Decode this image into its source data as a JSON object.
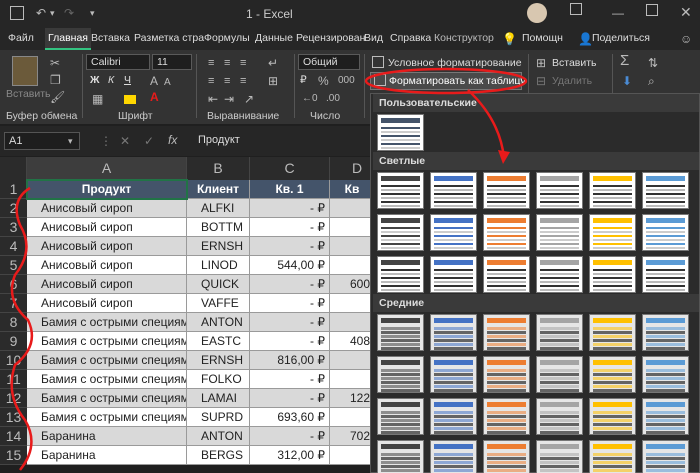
{
  "titlebar": {
    "doc_title": "1  -  Excel"
  },
  "tabs": [
    "Файл",
    "Главная",
    "Вставка",
    "Разметка стра",
    "Формулы",
    "Данные",
    "Рецензирован",
    "Вид",
    "Справка",
    "Конструктор",
    "Помощн",
    "Поделиться"
  ],
  "ribbon": {
    "paste_label": "Вставить",
    "font_name": "Calibri",
    "font_size": "11",
    "number_format": "Общий",
    "cond_format": "Условное форматирование",
    "format_table": "Форматировать как таблицу",
    "insert_label": "Вставить",
    "delete_label": "Удалить",
    "groups": {
      "clipboard": "Буфер обмена",
      "font": "Шрифт",
      "alignment": "Выравнивание",
      "number": "Число"
    },
    "bold": "Ж",
    "italic": "К",
    "underline": "Ч",
    "currency": "₽"
  },
  "formula_bar": {
    "name_box": "A1",
    "fx": "fx",
    "value": "Продукт"
  },
  "grid": {
    "columns": [
      "A",
      "B",
      "C",
      "D"
    ],
    "rows": [
      {
        "n": "1",
        "a": "Продукт",
        "b": "Клиент",
        "c": "Кв. 1",
        "d": "Кв"
      },
      {
        "n": "2",
        "a": "Анисовый сироп",
        "b": "ALFKI",
        "c": "-    ₽",
        "d": ""
      },
      {
        "n": "3",
        "a": "Анисовый сироп",
        "b": "BOTTM",
        "c": "-    ₽",
        "d": ""
      },
      {
        "n": "4",
        "a": "Анисовый сироп",
        "b": "ERNSH",
        "c": "-    ₽",
        "d": ""
      },
      {
        "n": "5",
        "a": "Анисовый сироп",
        "b": "LINOD",
        "c": "544,00 ₽",
        "d": ""
      },
      {
        "n": "6",
        "a": "Анисовый сироп",
        "b": "QUICK",
        "c": "-    ₽",
        "d": "600"
      },
      {
        "n": "7",
        "a": "Анисовый сироп",
        "b": "VAFFE",
        "c": "-    ₽",
        "d": ""
      },
      {
        "n": "8",
        "a": "Бамия с острыми специями",
        "b": "ANTON",
        "c": "-    ₽",
        "d": ""
      },
      {
        "n": "9",
        "a": "Бамия с острыми специями",
        "b": "EASTC",
        "c": "-    ₽",
        "d": "408"
      },
      {
        "n": "10",
        "a": "Бамия с острыми специями",
        "b": "ERNSH",
        "c": "816,00 ₽",
        "d": ""
      },
      {
        "n": "11",
        "a": "Бамия с острыми специями",
        "b": "FOLKO",
        "c": "-    ₽",
        "d": ""
      },
      {
        "n": "12",
        "a": "Бамия с острыми специями",
        "b": "LAMAI",
        "c": "-    ₽",
        "d": "122"
      },
      {
        "n": "13",
        "a": "Бамия с острыми специями",
        "b": "SUPRD",
        "c": "693,60 ₽",
        "d": ""
      },
      {
        "n": "14",
        "a": "Баранина",
        "b": "ANTON",
        "c": "-    ₽",
        "d": "702"
      },
      {
        "n": "15",
        "a": "Баранина",
        "b": "BERGS",
        "c": "312,00 ₽",
        "d": ""
      }
    ]
  },
  "gallery": {
    "sections": {
      "custom": "Пользовательские",
      "light": "Светлые",
      "medium": "Средние"
    },
    "light_colors": [
      "#444444",
      "#4472c4",
      "#ed7d31",
      "#a5a5a5",
      "#ffc000",
      "#5b9bd5"
    ],
    "medium_colors": [
      "#444444",
      "#4472c4",
      "#ed7d31",
      "#a5a5a5",
      "#ffc000",
      "#5b9bd5"
    ]
  },
  "accent": "#33c481",
  "header_fill": "#44546a",
  "annotation_color": "#e81b1b"
}
